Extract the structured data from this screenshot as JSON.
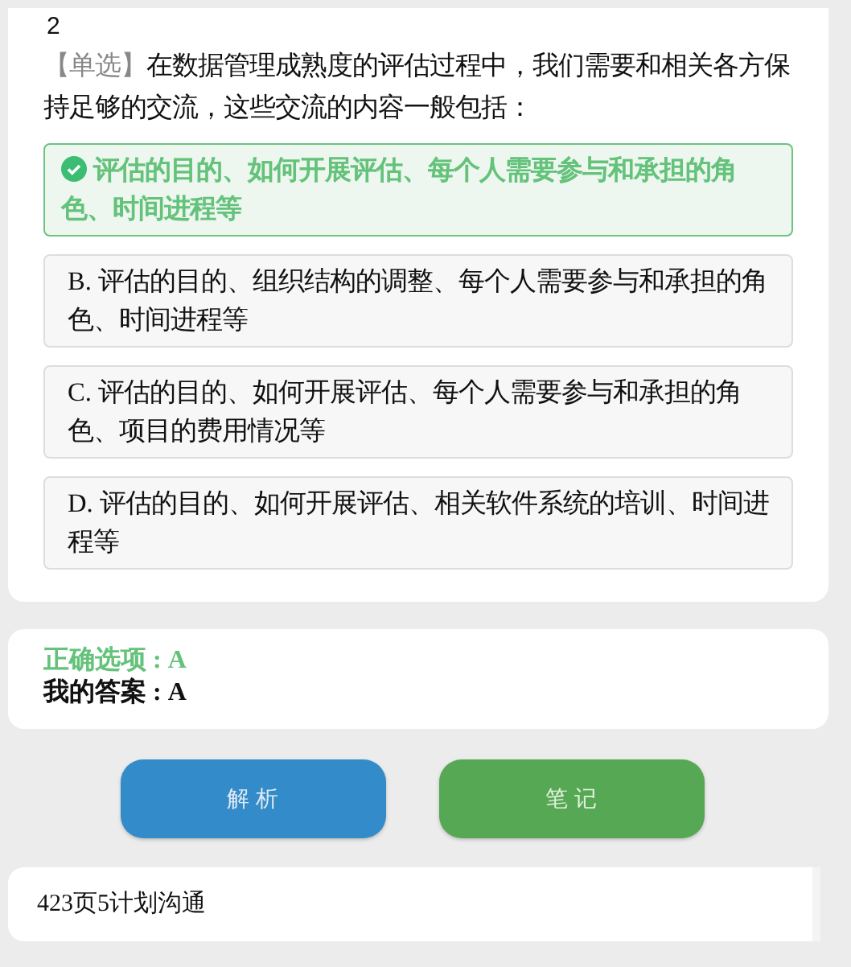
{
  "question": {
    "number": "2",
    "type_tag": "【单选】",
    "text": "在数据管理成熟度的评估过程中，我们需要和相关各方保持足够的交流，这些交流的内容一般包括："
  },
  "options": [
    {
      "text": "评估的目的、如何开展评估、每个人需要参与和承担的角色、时间进程等",
      "selected": true
    },
    {
      "text": " B. 评估的目的、组织结构的调整、每个人需要参与和承担的角色、时间进程等",
      "selected": false
    },
    {
      "text": " C. 评估的目的、如何开展评估、每个人需要参与和承担的角色、项目的费用情况等",
      "selected": false
    },
    {
      "text": " D. 评估的目的、如何开展评估、相关软件系统的培训、时间进程等",
      "selected": false
    }
  ],
  "answer": {
    "correct": "正确选项 : A",
    "mine": "我的答案 : A"
  },
  "buttons": [
    {
      "label": "解 析",
      "kind": "analysis"
    },
    {
      "label": "笔 记",
      "kind": "notes"
    }
  ],
  "note": "423页5计划沟通"
}
